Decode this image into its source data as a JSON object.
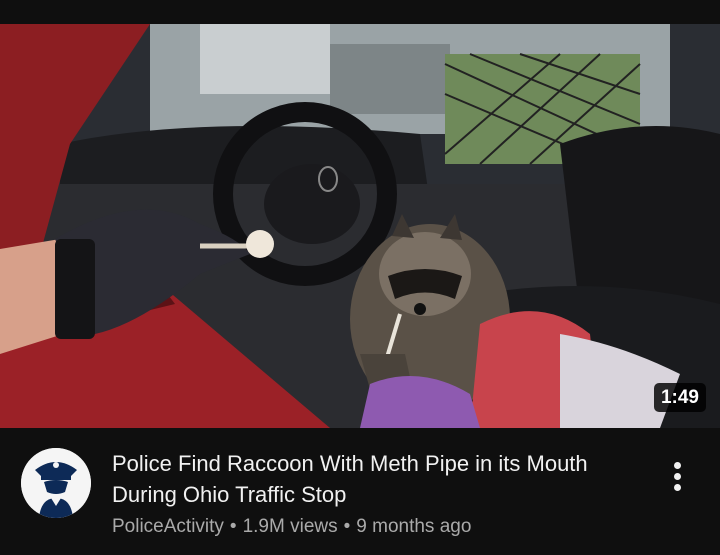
{
  "video": {
    "duration": "1:49",
    "title": "Police Find Raccoon With Meth Pipe in its Mouth During Ohio Traffic Stop",
    "channel": "PoliceActivity",
    "views": "1.9M views",
    "age": "9 months ago",
    "separator": "•"
  },
  "icons": {
    "channel_avatar": "police-officer-avatar-icon",
    "menu": "more-vertical-icon"
  },
  "colors": {
    "background": "#0f0f0f",
    "title_text": "#f1f1f1",
    "secondary_text": "#aaaaaa",
    "duration_badge": "#000000"
  }
}
